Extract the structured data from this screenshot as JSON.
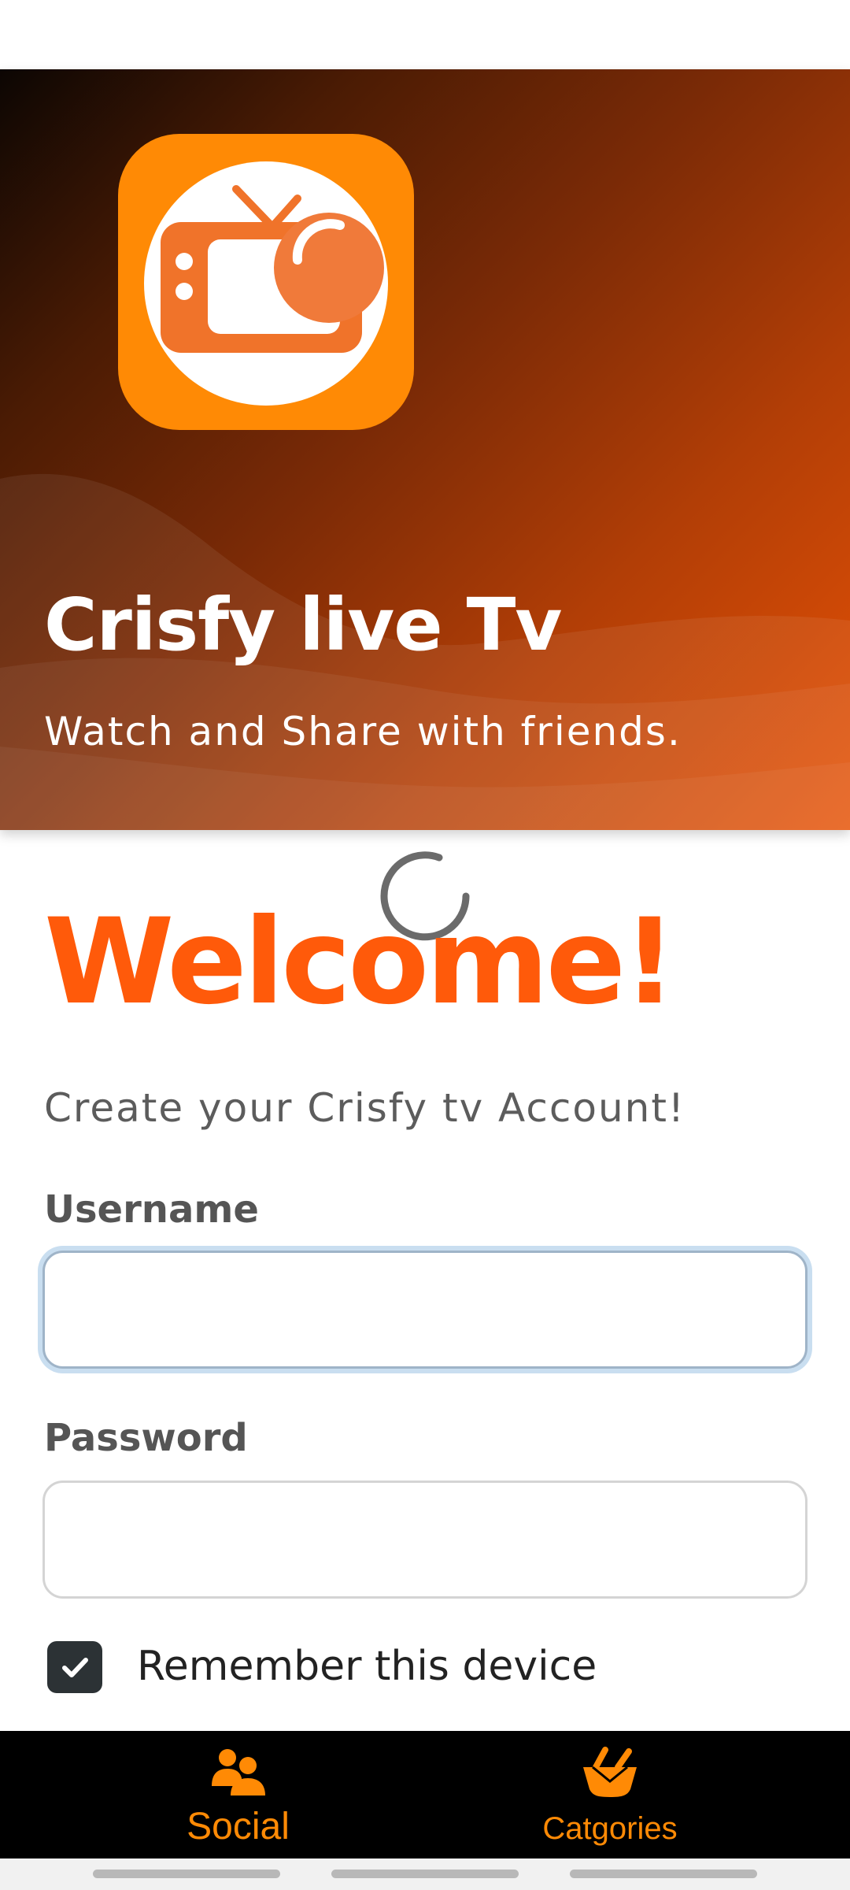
{
  "header": {
    "title": "Crisfy live Tv",
    "subtitle": "Watch and Share with friends."
  },
  "welcome": {
    "heading": "Welcome!",
    "subheading": "Create your Crisfy tv Account!"
  },
  "form": {
    "username_label": "Username",
    "username_value": "",
    "password_label": "Password",
    "password_value": "",
    "remember_label": "Remember this device",
    "remember_checked": true
  },
  "bottom_nav": {
    "items": [
      {
        "label": "Social",
        "icon": "users-icon"
      },
      {
        "label": "Catgories",
        "icon": "basket-icon"
      }
    ]
  },
  "colors": {
    "accent": "#ff5a0a",
    "logo_bg": "#ff8a05",
    "nav_label": "#ff8a05",
    "nav_bg": "#000000"
  }
}
